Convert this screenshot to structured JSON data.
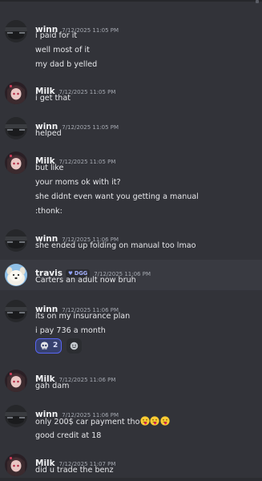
{
  "messages": [
    {
      "author": "winn",
      "timestamp": "7/12/2025 11:05 PM",
      "lines": [
        "i paid for it",
        "well most of it",
        "my dad b yelled"
      ]
    },
    {
      "author": "Milk",
      "timestamp": "7/12/2025 11:05 PM",
      "lines": [
        "i get that"
      ]
    },
    {
      "author": "winn",
      "timestamp": "7/12/2025 11:05 PM",
      "lines": [
        "helped"
      ]
    },
    {
      "author": "Milk",
      "timestamp": "7/12/2025 11:05 PM",
      "lines": [
        "but like",
        "your moms ok with it?",
        "she didnt even want you getting a manual",
        ":thonk:"
      ]
    },
    {
      "author": "winn",
      "timestamp": "7/12/2025 11:06 PM",
      "lines": [
        "she ended up folding on manual too lmao"
      ]
    },
    {
      "author": "travis",
      "badge": "DGG",
      "timestamp": "7/12/2025 11:06 PM",
      "lines": [
        "Carters an adult now bruh"
      ]
    },
    {
      "author": "winn",
      "timestamp": "7/12/2025 11:06 PM",
      "lines": [
        "its on my insurance plan",
        "i pay 736 a month"
      ],
      "reaction": {
        "icon": "skull-icon",
        "count": "2"
      }
    },
    {
      "author": "Milk",
      "timestamp": "7/12/2025 11:06 PM",
      "lines": [
        "gah dam"
      ]
    },
    {
      "author": "winn",
      "timestamp": "7/12/2025 11:06 PM",
      "lines": [
        "only 200$ car payment tho",
        "good credit at 18"
      ],
      "emojis": [
        "tongue-out-emoji",
        "tongue-out-emoji",
        "tongue-out-emoji"
      ]
    },
    {
      "author": "Milk",
      "timestamp": "7/12/2025 11:07 PM",
      "lines": [
        "did u trade the benz"
      ]
    }
  ],
  "colors": {
    "background": "#323339",
    "highlight": "#393a41",
    "reaction_accent": "#5865f2",
    "badge_text": "#a5b1ff"
  }
}
